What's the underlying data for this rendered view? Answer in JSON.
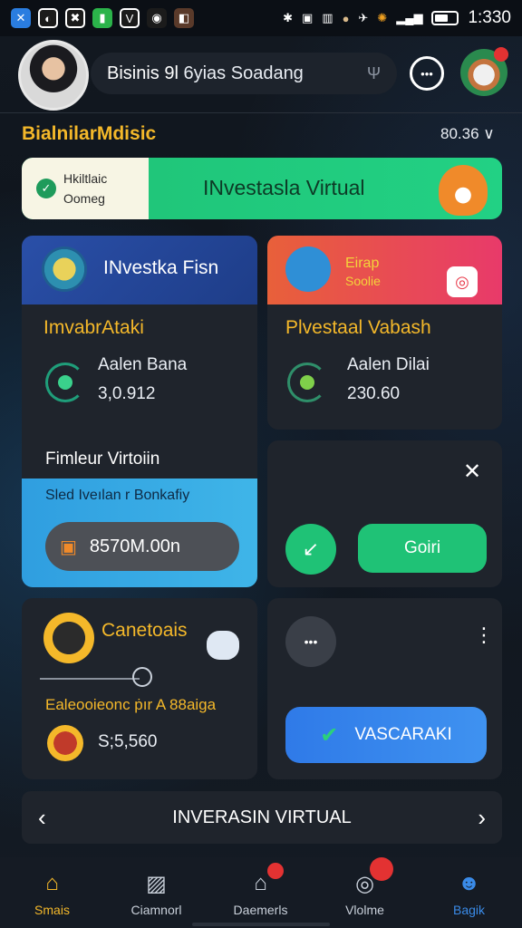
{
  "status_bar": {
    "time": "1:330",
    "icons": [
      "app-icon",
      "app-icon",
      "app-icon",
      "app-icon",
      "app-icon",
      "app-icon",
      "app-icon",
      "bluetooth-icon",
      "nfc-icon",
      "vibrate-icon",
      "coin-icon",
      "wifi-icon",
      "settings-icon",
      "signal-icon",
      "battery-icon"
    ]
  },
  "header": {
    "search_prefix": "Bisinis 9l",
    "search_text": "6yias Soadang",
    "notification_count": ""
  },
  "section": {
    "title": "BialnilarMdisic",
    "balance": "80.36",
    "balance_chevron": "∨"
  },
  "banner": {
    "small_line1": "Hkiltlaic",
    "small_line2": "Oomeg",
    "title": "INvestasla Virtual"
  },
  "card_investka": {
    "head_title": "INvestka Fisn",
    "label": "ImvabrAtaki",
    "line1": "Aalen Bana",
    "line2": "3,0.912",
    "sub_title": "Fimleur Virtoiin",
    "sub_desc": "Sled Iveılan r Bonkafiy",
    "amount": "8570M.00n"
  },
  "card_eirap": {
    "head_line1": "Eirap",
    "head_line2": "Soolie",
    "label": "Plvestaal Vabash",
    "line1": "Aalen Dilai",
    "line2": "230.60"
  },
  "card_action": {
    "close": "✕",
    "button": "Goiri"
  },
  "card_canetoais": {
    "title": "Canetoais",
    "label": "Ealeooieonc ṗır A 88aiga",
    "amount": "S;5,560"
  },
  "card_vascaraki": {
    "button": "VASCARAKI",
    "menu": "⋮"
  },
  "nav_strip": {
    "label": "INVERASIN VIRTUAL",
    "prev": "‹",
    "next": "›"
  },
  "tabbar": {
    "tabs": [
      {
        "label": "Smais",
        "icon": "home-icon",
        "active": true
      },
      {
        "label": "Ciamnorl",
        "icon": "chart-icon",
        "active": false
      },
      {
        "label": "Daemerls",
        "icon": "lock-icon",
        "active": false,
        "badge": ""
      },
      {
        "label": "Vlolme",
        "icon": "record-icon",
        "active": false,
        "badge": ""
      },
      {
        "label": "Bagik",
        "icon": "user-icon",
        "active": false
      }
    ]
  },
  "colors": {
    "accent_gold": "#f4b82a",
    "accent_green": "#1fc276",
    "accent_blue": "#3a8be8"
  }
}
